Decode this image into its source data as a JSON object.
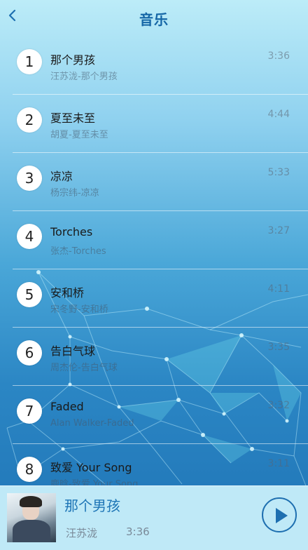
{
  "header": {
    "title": "音乐",
    "back_icon": "chevron-left-icon"
  },
  "songs": [
    {
      "index": "1",
      "name": "那个男孩",
      "subtitle": "汪苏泷-那个男孩",
      "duration": "3:36"
    },
    {
      "index": "2",
      "name": "夏至未至",
      "subtitle": "胡夏-夏至未至",
      "duration": "4:44"
    },
    {
      "index": "3",
      "name": "凉凉",
      "subtitle": "杨宗纬-凉凉",
      "duration": "5:33"
    },
    {
      "index": "4",
      "name": "Torches",
      "subtitle": "张杰-Torches",
      "duration": "3:27"
    },
    {
      "index": "5",
      "name": "安和桥",
      "subtitle": "宋冬野-安和桥",
      "duration": "4:11"
    },
    {
      "index": "6",
      "name": "告白气球",
      "subtitle": "周杰伦-告白气球",
      "duration": "3:35"
    },
    {
      "index": "7",
      "name": "Faded",
      "subtitle": "Alan Walker-Faded",
      "duration": "3:32"
    },
    {
      "index": "8",
      "name": "致爱 Your Song",
      "subtitle": "鹿晗-致爱 Your Song",
      "duration": "3:11"
    }
  ],
  "player": {
    "title": "那个男孩",
    "artist": "汪苏泷",
    "time": "3:36",
    "play_icon": "play-icon"
  },
  "colors": {
    "accent": "#1e6fb0",
    "player_bg": "#bfe9f7"
  }
}
